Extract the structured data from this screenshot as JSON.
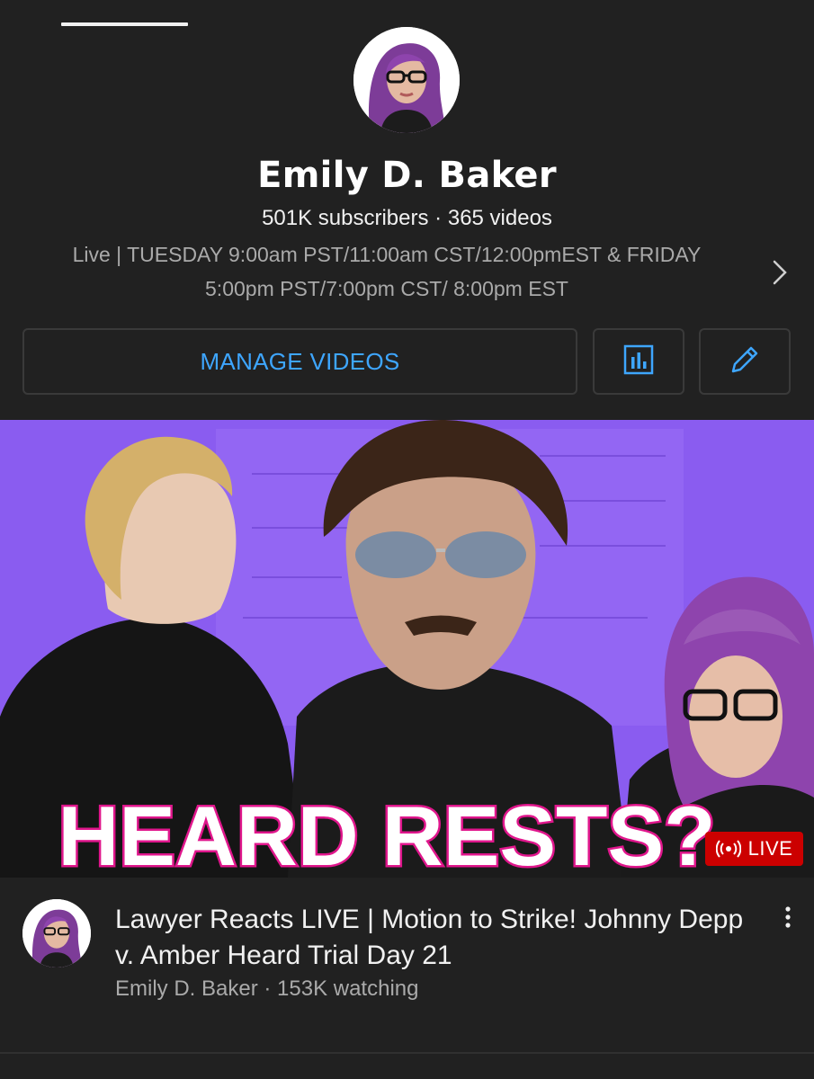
{
  "channel": {
    "name": "Emily D. Baker",
    "subscribers": "501K subscribers",
    "separator": "·",
    "videos": "365 videos",
    "description": "Live | TUESDAY 9:00am PST/11:00am CST/12:00pmEST  &  FRIDAY\n5:00pm PST/7:00pm CST/ 8:00pm EST"
  },
  "actions": {
    "manage_videos": "MANAGE VIDEOS",
    "analytics_icon": "bar-chart-icon",
    "edit_icon": "pencil-icon"
  },
  "video": {
    "thumbnail_text": "HEARD RESTS?",
    "live_label": "LIVE",
    "title": "Lawyer Reacts LIVE | Motion to Strike! Johnny Depp v. Amber Heard Trial Day 21",
    "meta": "Emily D. Baker · 153K watching"
  },
  "colors": {
    "background": "#212121",
    "accent": "#3ea6ff",
    "live": "#cc0000",
    "thumbnail_bg": "#8a5cf0",
    "thumbnail_text_fill": "#ffffff",
    "thumbnail_text_stroke": "#e0168c"
  }
}
